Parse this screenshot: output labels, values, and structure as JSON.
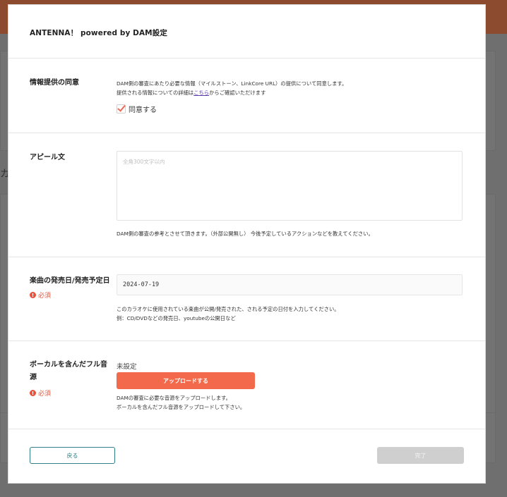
{
  "modal": {
    "title": "ANTENNA！ powered by DAM設定"
  },
  "background": {
    "partial_char": "カ"
  },
  "sections": {
    "consent": {
      "label": "情報提供の同意",
      "desc_line1": "DAM側の審査にあたり必要な情報（マイルストーン、LinkCore URL）の提供について同意します。",
      "desc_line2_prefix": "提供される情報についての詳細は",
      "desc_link": "こちら",
      "desc_line2_suffix": "からご確認いただけます",
      "checkbox_label": "同意する",
      "checked": true
    },
    "appeal": {
      "label": "アピール文",
      "placeholder": "全角300文字以内",
      "help": "DAM側の審査の参考とさせて頂きます。（外部公開無し） 今後予定しているアクションなどを教えてください。"
    },
    "release_date": {
      "label": "楽曲の発売日/発売予定日",
      "required": "必須",
      "value": "2024-07-19",
      "help_line1": "このカラオケに使用されている楽曲が公開/発売された、される予定の日付を入力してください。",
      "help_line2": "例：CD/DVDなどの発売日、youtubeの公開日など"
    },
    "vocal_audio": {
      "label_line1": "ボーカルを含んだフル音",
      "label_line2": "源",
      "required": "必須",
      "status": "未設定",
      "upload_label": "アップロードする",
      "help_line1": "DAMの審査に必要な音源をアップロードします。",
      "help_line2": "ボーカルを含んだフル音源をアップロードして下さい。"
    }
  },
  "footer": {
    "back_label": "戻る",
    "done_label": "完了"
  },
  "colors": {
    "accent": "#f26a4b",
    "required": "#e8523a",
    "back_border": "#2f7f86",
    "done_disabled": "#cfcfcf"
  }
}
